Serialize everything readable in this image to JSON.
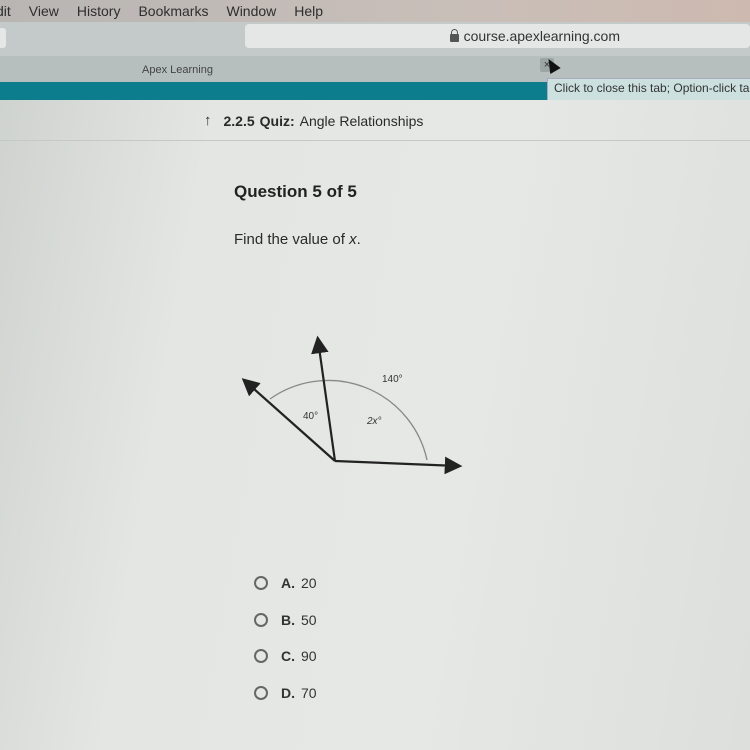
{
  "menubar": {
    "items": [
      "dit",
      "View",
      "History",
      "Bookmarks",
      "Window",
      "Help"
    ]
  },
  "browser": {
    "url": "course.apexlearning.com",
    "tab_title": "Apex Learning",
    "tab_close_glyph": "×",
    "tooltip": "Click to close this tab; Option-click tabs except this one"
  },
  "page": {
    "breadcrumb": {
      "number": "2.2.5",
      "type": "Quiz:",
      "title": "Angle Relationships"
    },
    "question_title": "Question 5 of 5",
    "prompt_prefix": "Find the value of ",
    "prompt_var": "x",
    "prompt_suffix": "."
  },
  "figure": {
    "labels": {
      "outer_angle": "140°",
      "left_angle": "40°",
      "right_angle": "2x°"
    }
  },
  "options": [
    {
      "letter": "A.",
      "value": "20"
    },
    {
      "letter": "B.",
      "value": "50"
    },
    {
      "letter": "C.",
      "value": "90"
    },
    {
      "letter": "D.",
      "value": "70"
    }
  ]
}
